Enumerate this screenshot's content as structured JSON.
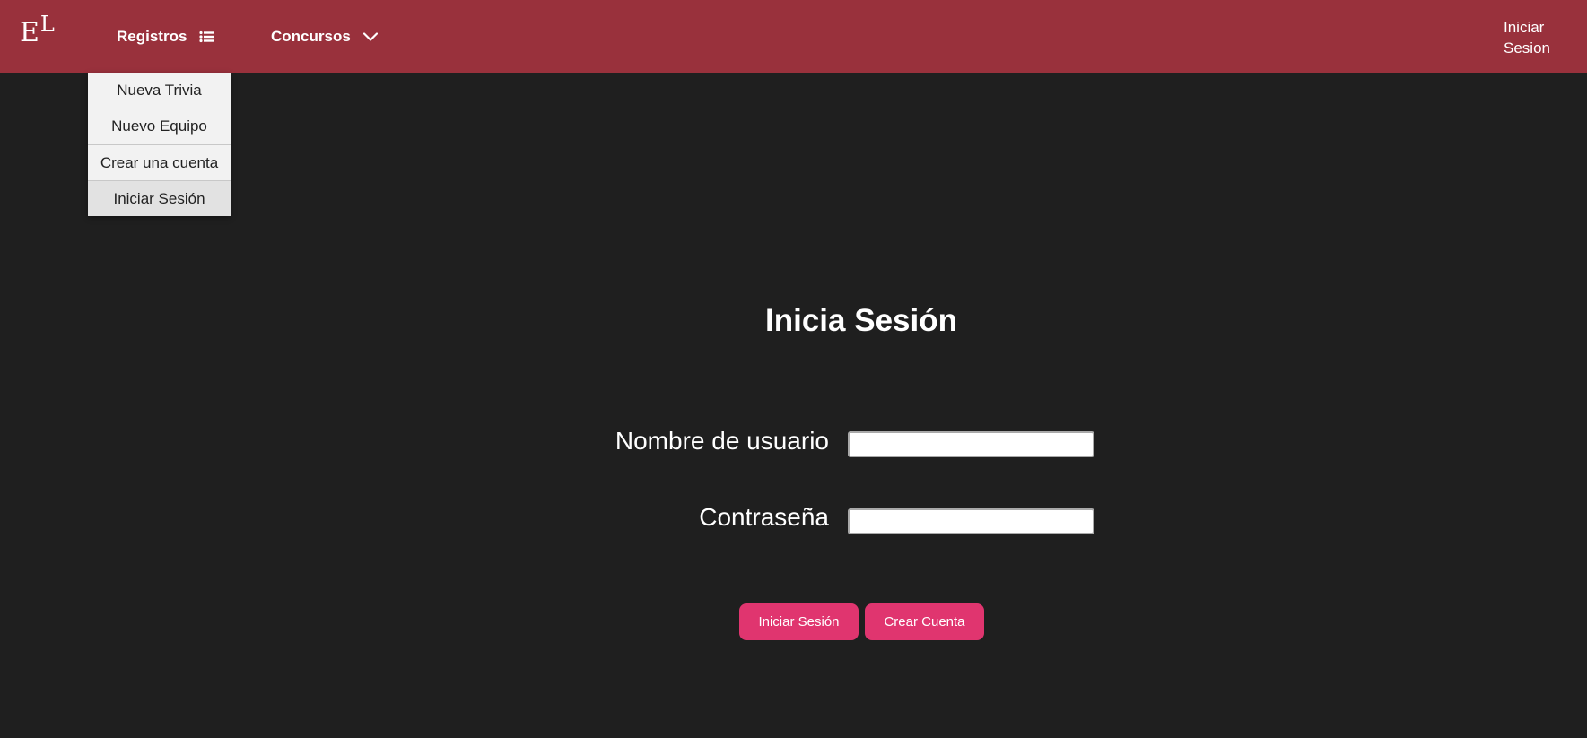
{
  "navbar": {
    "logo": {
      "letter_e": "E",
      "letter_l": "L"
    },
    "registros_label": "Registros",
    "registros_icon": "list-icon",
    "concursos_label": "Concursos",
    "concursos_icon": "chevron-down-icon",
    "login_label": "Iniciar Sesion",
    "background_color": "#99313c"
  },
  "dropdown": {
    "items": [
      {
        "label": "Nueva Trivia"
      },
      {
        "label": "Nuevo Equipo"
      },
      {
        "label": "Crear una cuenta"
      },
      {
        "label": "Iniciar Sesión"
      }
    ]
  },
  "login_form": {
    "title": "Inicia Sesión",
    "username_label": "Nombre de usuario",
    "username_value": "",
    "password_label": "Contraseña",
    "password_value": "",
    "login_button": "Iniciar Sesión",
    "create_button": "Crear Cuenta",
    "button_color": "#e0356f"
  }
}
